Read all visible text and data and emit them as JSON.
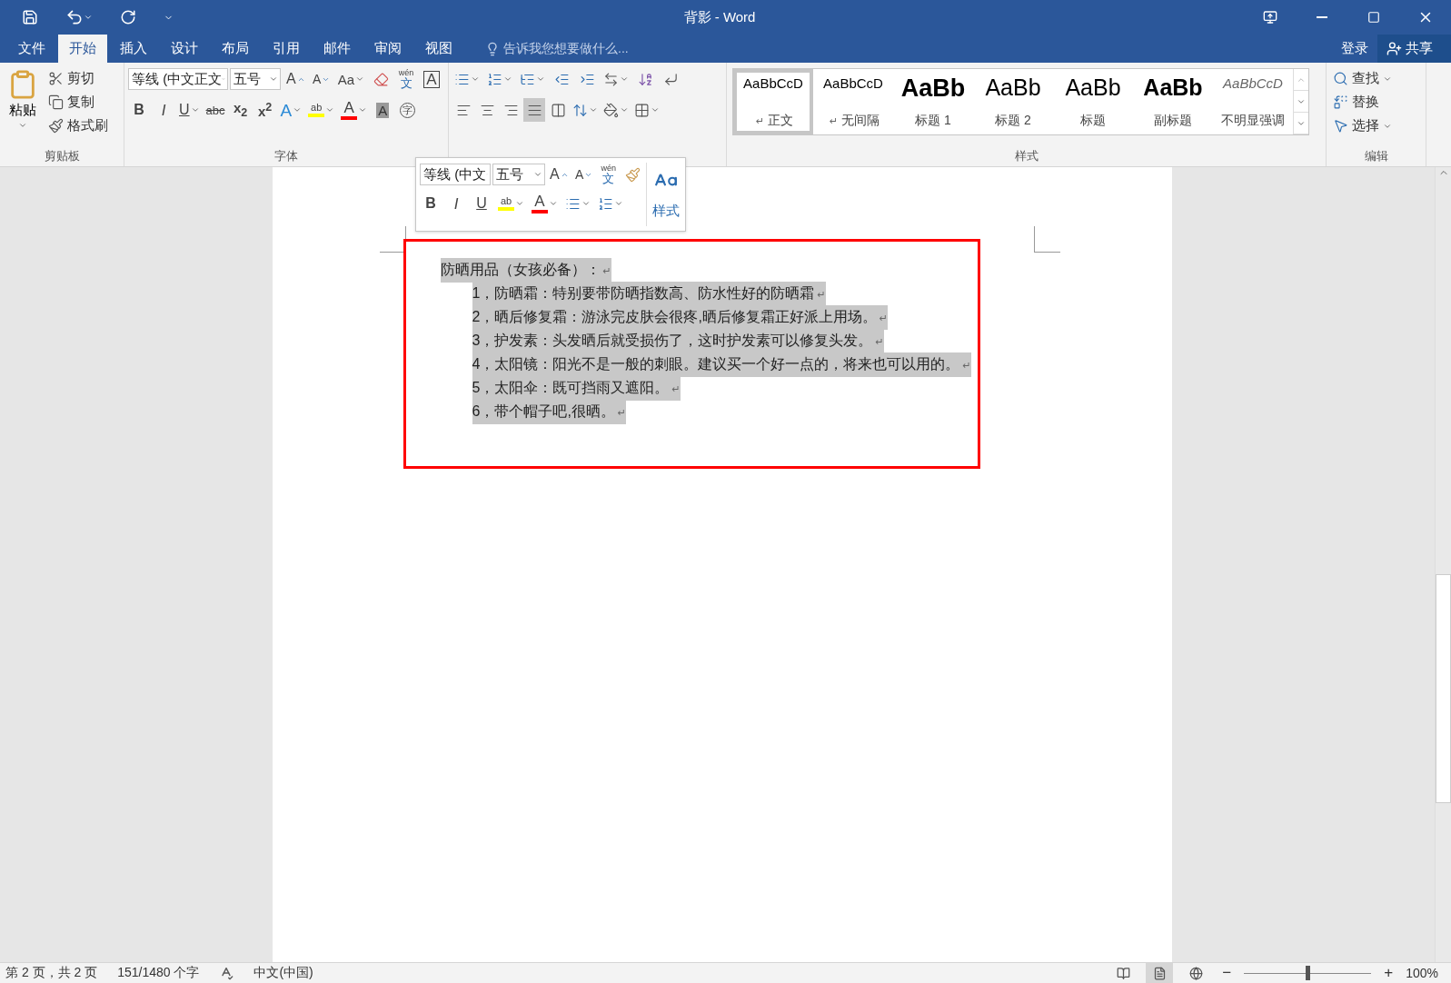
{
  "window": {
    "title": "背影 - Word"
  },
  "tabs": [
    {
      "label": "文件",
      "selected": false
    },
    {
      "label": "开始",
      "selected": true
    },
    {
      "label": "插入",
      "selected": false
    },
    {
      "label": "设计",
      "selected": false
    },
    {
      "label": "布局",
      "selected": false
    },
    {
      "label": "引用",
      "selected": false
    },
    {
      "label": "邮件",
      "selected": false
    },
    {
      "label": "审阅",
      "selected": false
    },
    {
      "label": "视图",
      "selected": false
    }
  ],
  "tell_me": {
    "placeholder": "告诉我您想要做什么..."
  },
  "account": {
    "sign_in": "登录",
    "share": "共享"
  },
  "clipboard": {
    "title": "剪贴板",
    "paste": "粘贴",
    "tools": [
      {
        "kind": "cut",
        "label": "剪切"
      },
      {
        "kind": "copy",
        "label": "复制"
      },
      {
        "kind": "painter",
        "label": "格式刷"
      }
    ]
  },
  "font": {
    "title": "字体",
    "name": "等线 (中文正文",
    "size": "五号",
    "row_1": [
      {
        "kind": "grow",
        "text": "A"
      },
      {
        "kind": "shrink",
        "text": "A"
      },
      {
        "kind": "case",
        "text": "Aa"
      },
      {
        "kind": "clear"
      },
      {
        "kind": "phonetic",
        "text": "wén",
        "char": "文"
      },
      {
        "kind": "border",
        "text": "A"
      }
    ],
    "row_2": [
      {
        "kind": "bold",
        "text": "B"
      },
      {
        "kind": "italic",
        "text": "I"
      },
      {
        "kind": "underline",
        "text": "U"
      },
      {
        "kind": "strike",
        "text": "abc"
      },
      {
        "kind": "sub",
        "text": "x$_{2}$"
      },
      {
        "kind": "sup",
        "text": "x$^{2}$"
      },
      {
        "kind": "effects",
        "text": "A"
      },
      {
        "kind": "highlight",
        "text": "ab"
      },
      {
        "kind": "color",
        "text": "A"
      },
      {
        "kind": "shading",
        "text": "A"
      },
      {
        "kind": "enclose",
        "text": "字"
      }
    ]
  },
  "paragraph": {
    "align": [
      {
        "kind": "left",
        "selected": false
      },
      {
        "kind": "center",
        "selected": false
      },
      {
        "kind": "right",
        "selected": false
      },
      {
        "kind": "justify",
        "selected": true
      },
      {
        "kind": "distributed",
        "selected": false
      }
    ]
  },
  "styles": {
    "title": "样式",
    "items": [
      {
        "kind": "normal",
        "preview": "AaBbCcD",
        "name": "正文",
        "mark": "↵",
        "selected": true
      },
      {
        "kind": "nospacing",
        "preview": "AaBbCcD",
        "name": "无间隔",
        "mark": "↵",
        "selected": false
      },
      {
        "kind": "heading1",
        "preview": "AaBb",
        "name": "标题 1",
        "selected": false
      },
      {
        "kind": "heading2",
        "preview": "AaBb",
        "name": "标题 2",
        "selected": false
      },
      {
        "kind": "title",
        "preview": "AaBb",
        "name": "标题",
        "selected": false
      },
      {
        "kind": "subtitle",
        "preview": "AaBb",
        "name": "副标题",
        "selected": false
      },
      {
        "kind": "emphasis",
        "preview": "AaBbCcD",
        "name": "不明显强调",
        "selected": false
      }
    ]
  },
  "editing": {
    "title": "编辑",
    "tools": [
      {
        "kind": "find",
        "label": "查找"
      },
      {
        "kind": "replace",
        "label": "替换"
      },
      {
        "kind": "select",
        "label": "选择"
      }
    ]
  },
  "mini_toolbar": {
    "font": "等线 (中文",
    "size": "五号",
    "styles": "样式",
    "row_1": [
      {
        "kind": "grow",
        "text": "A"
      },
      {
        "kind": "shrink",
        "text": "A"
      },
      {
        "kind": "phonetic",
        "text": "wén",
        "char": "文"
      },
      {
        "kind": "painter"
      }
    ],
    "row_2": [
      {
        "kind": "bold",
        "text": "B"
      },
      {
        "kind": "italic",
        "text": "I"
      },
      {
        "kind": "underline",
        "text": "U"
      },
      {
        "kind": "highlight",
        "text": "ab"
      },
      {
        "kind": "color",
        "text": "A"
      },
      {
        "kind": "bullets"
      },
      {
        "kind": "numbering"
      }
    ]
  },
  "document": {
    "heading": {
      "text": "防晒用品（女孩必备）：",
      "mark": "↵",
      "selected": true
    },
    "items": [
      {
        "number": "1，",
        "text": "防晒霜：特别要带防晒指数高、防水性好的防晒霜",
        "mark": "↵",
        "selected": true
      },
      {
        "number": "2，",
        "text": "晒后修复霜：游泳完皮肤会很疼,晒后修复霜正好派上用场。",
        "mark": "↵",
        "selected": true
      },
      {
        "number": "3，",
        "text": "护发素：头发晒后就受损伤了，这时护发素可以修复头发。",
        "mark": "↵",
        "selected": true
      },
      {
        "number": "4，",
        "text": "太阳镜：阳光不是一般的刺眼。建议买一个好一点的，将来也可以用的。",
        "mark": "↵",
        "selected": true
      },
      {
        "number": "5，",
        "text": "太阳伞：既可挡雨又遮阳。",
        "mark": "↵",
        "selected": true
      },
      {
        "number": "6，",
        "text": "带个帽子吧,很晒。",
        "mark": "↵",
        "selected": true
      }
    ]
  },
  "status_bar": {
    "page": "第 2 页，共 2 页",
    "words": "151/1480 个字",
    "language": "中文(中国)",
    "zoom_out": "−",
    "zoom_in": "+",
    "zoom": "100%",
    "zoom_slider": {
      "level": 0.5
    }
  }
}
